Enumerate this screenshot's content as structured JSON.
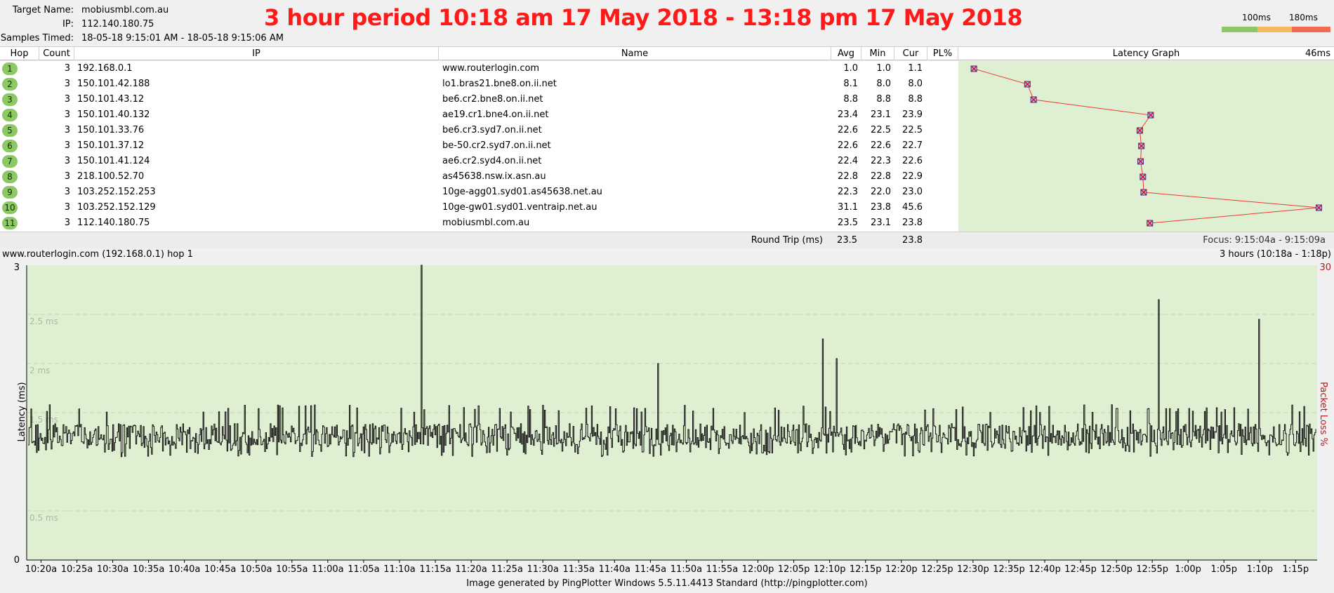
{
  "meta": {
    "target_label": "Target Name:",
    "target_value": "mobiusmbl.com.au",
    "ip_label": "IP:",
    "ip_value": "112.140.180.75",
    "samples_label": "Samples Timed:",
    "samples_value": "18-05-18 9:15:01 AM - 18-05-18 9:15:06 AM"
  },
  "banner": "3 hour period 10:18 am 17 May 2018 - 13:18 pm 17 May 2018",
  "scale_legend": {
    "label1": "100ms",
    "label2": "180ms",
    "colors": [
      "#8ec865",
      "#f5b95b",
      "#f26b53"
    ]
  },
  "table": {
    "headers": {
      "hop": "Hop",
      "count": "Count",
      "ip": "IP",
      "name": "Name",
      "avg": "Avg",
      "min": "Min",
      "cur": "Cur",
      "pl": "PL%",
      "graph": "Latency Graph",
      "graph_max": "46ms"
    },
    "rows": [
      {
        "hop": "1",
        "count": "3",
        "ip": "192.168.0.1",
        "name": "www.routerlogin.com",
        "avg": "1.0",
        "min": "1.0",
        "cur": "1.1"
      },
      {
        "hop": "2",
        "count": "3",
        "ip": "150.101.42.188",
        "name": "lo1.bras21.bne8.on.ii.net",
        "avg": "8.1",
        "min": "8.0",
        "cur": "8.0"
      },
      {
        "hop": "3",
        "count": "3",
        "ip": "150.101.43.12",
        "name": "be6.cr2.bne8.on.ii.net",
        "avg": "8.8",
        "min": "8.8",
        "cur": "8.8"
      },
      {
        "hop": "4",
        "count": "3",
        "ip": "150.101.40.132",
        "name": "ae19.cr1.bne4.on.ii.net",
        "avg": "23.4",
        "min": "23.1",
        "cur": "23.9"
      },
      {
        "hop": "5",
        "count": "3",
        "ip": "150.101.33.76",
        "name": "be6.cr3.syd7.on.ii.net",
        "avg": "22.6",
        "min": "22.5",
        "cur": "22.5"
      },
      {
        "hop": "6",
        "count": "3",
        "ip": "150.101.37.12",
        "name": "be-50.cr2.syd7.on.ii.net",
        "avg": "22.6",
        "min": "22.6",
        "cur": "22.7"
      },
      {
        "hop": "7",
        "count": "3",
        "ip": "150.101.41.124",
        "name": "ae6.cr2.syd4.on.ii.net",
        "avg": "22.4",
        "min": "22.3",
        "cur": "22.6"
      },
      {
        "hop": "8",
        "count": "3",
        "ip": "218.100.52.70",
        "name": "as45638.nsw.ix.asn.au",
        "avg": "22.8",
        "min": "22.8",
        "cur": "22.9"
      },
      {
        "hop": "9",
        "count": "3",
        "ip": "103.252.152.253",
        "name": "10ge-agg01.syd01.as45638.net.au",
        "avg": "22.3",
        "min": "22.0",
        "cur": "23.0"
      },
      {
        "hop": "10",
        "count": "3",
        "ip": "103.252.152.129",
        "name": "10ge-gw01.syd01.ventraip.net.au",
        "avg": "31.1",
        "min": "23.8",
        "cur": "45.6"
      },
      {
        "hop": "11",
        "count": "3",
        "ip": "112.140.180.75",
        "name": "mobiusmbl.com.au",
        "avg": "23.5",
        "min": "23.1",
        "cur": "23.8"
      }
    ],
    "round_trip": {
      "label": "Round Trip (ms)",
      "avg": "23.5",
      "cur": "23.8"
    },
    "focus": "Focus: 9:15:04a - 9:15:09a"
  },
  "lower_chart": {
    "title": "www.routerlogin.com (192.168.0.1) hop 1",
    "range": "3 hours (10:18a - 1:18p)",
    "packet_loss_max": "30",
    "y_axis_label": "Latency (ms)",
    "y2_axis_label": "Packet Loss %",
    "y_ticks": [
      "3",
      "0"
    ],
    "gridlines": [
      "2.5 ms",
      "2 ms",
      "1.5 ms",
      "0.5 ms"
    ],
    "x_ticks": [
      "10:20a",
      "10:25a",
      "10:30a",
      "10:35a",
      "10:40a",
      "10:45a",
      "10:50a",
      "10:55a",
      "11:00a",
      "11:05a",
      "11:10a",
      "11:15a",
      "11:20a",
      "11:25a",
      "11:30a",
      "11:35a",
      "11:40a",
      "11:45a",
      "11:50a",
      "11:55a",
      "12:00p",
      "12:05p",
      "12:10p",
      "12:15p",
      "12:20p",
      "12:25p",
      "12:30p",
      "12:35p",
      "12:40p",
      "12:45p",
      "12:50p",
      "12:55p",
      "1:00p",
      "1:05p",
      "1:10p",
      "1:15p"
    ]
  },
  "chart_data": {
    "type": "line",
    "title": "www.routerlogin.com (192.168.0.1) hop 1",
    "xlabel": "",
    "ylabel": "Latency (ms)",
    "y2label": "Packet Loss %",
    "ylim": [
      0,
      3
    ],
    "y2lim": [
      0,
      30
    ],
    "x_range": [
      "10:18a",
      "1:18p"
    ],
    "series": [
      {
        "values_summary": "latency samples fluctuating roughly between 1.0 and 1.5 ms",
        "typical_low": 1.05,
        "typical_high": 1.5,
        "spikes": [
          {
            "x": "11:13a",
            "y": 3.0
          },
          {
            "x": "11:46a",
            "y": 2.0
          },
          {
            "x": "12:09p",
            "y": 2.25
          },
          {
            "x": "12:11p",
            "y": 2.05
          },
          {
            "x": "12:56p",
            "y": 2.65
          },
          {
            "x": "1:10p",
            "y": 2.45
          }
        ]
      }
    ],
    "hop_latency_graph": {
      "type": "line",
      "xlim": [
        0,
        46
      ],
      "unit": "ms",
      "values": [
        1.0,
        8.1,
        8.8,
        23.4,
        22.6,
        22.6,
        22.4,
        22.8,
        22.3,
        31.1,
        23.5
      ],
      "current": [
        1.1,
        8.0,
        8.8,
        23.9,
        22.5,
        22.7,
        22.6,
        22.9,
        23.0,
        45.6,
        23.8
      ]
    }
  },
  "footer": "Image generated by PingPlotter Windows 5.5.11.4413 Standard (http://pingplotter.com)"
}
